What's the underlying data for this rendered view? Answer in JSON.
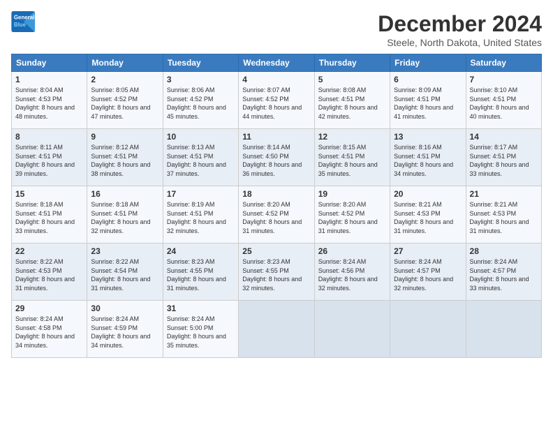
{
  "logo": {
    "line1": "General",
    "line2": "Blue"
  },
  "title": "December 2024",
  "location": "Steele, North Dakota, United States",
  "days_of_week": [
    "Sunday",
    "Monday",
    "Tuesday",
    "Wednesday",
    "Thursday",
    "Friday",
    "Saturday"
  ],
  "weeks": [
    [
      {
        "day": "1",
        "sunrise": "Sunrise: 8:04 AM",
        "sunset": "Sunset: 4:53 PM",
        "daylight": "Daylight: 8 hours and 48 minutes."
      },
      {
        "day": "2",
        "sunrise": "Sunrise: 8:05 AM",
        "sunset": "Sunset: 4:52 PM",
        "daylight": "Daylight: 8 hours and 47 minutes."
      },
      {
        "day": "3",
        "sunrise": "Sunrise: 8:06 AM",
        "sunset": "Sunset: 4:52 PM",
        "daylight": "Daylight: 8 hours and 45 minutes."
      },
      {
        "day": "4",
        "sunrise": "Sunrise: 8:07 AM",
        "sunset": "Sunset: 4:52 PM",
        "daylight": "Daylight: 8 hours and 44 minutes."
      },
      {
        "day": "5",
        "sunrise": "Sunrise: 8:08 AM",
        "sunset": "Sunset: 4:51 PM",
        "daylight": "Daylight: 8 hours and 42 minutes."
      },
      {
        "day": "6",
        "sunrise": "Sunrise: 8:09 AM",
        "sunset": "Sunset: 4:51 PM",
        "daylight": "Daylight: 8 hours and 41 minutes."
      },
      {
        "day": "7",
        "sunrise": "Sunrise: 8:10 AM",
        "sunset": "Sunset: 4:51 PM",
        "daylight": "Daylight: 8 hours and 40 minutes."
      }
    ],
    [
      {
        "day": "8",
        "sunrise": "Sunrise: 8:11 AM",
        "sunset": "Sunset: 4:51 PM",
        "daylight": "Daylight: 8 hours and 39 minutes."
      },
      {
        "day": "9",
        "sunrise": "Sunrise: 8:12 AM",
        "sunset": "Sunset: 4:51 PM",
        "daylight": "Daylight: 8 hours and 38 minutes."
      },
      {
        "day": "10",
        "sunrise": "Sunrise: 8:13 AM",
        "sunset": "Sunset: 4:51 PM",
        "daylight": "Daylight: 8 hours and 37 minutes."
      },
      {
        "day": "11",
        "sunrise": "Sunrise: 8:14 AM",
        "sunset": "Sunset: 4:50 PM",
        "daylight": "Daylight: 8 hours and 36 minutes."
      },
      {
        "day": "12",
        "sunrise": "Sunrise: 8:15 AM",
        "sunset": "Sunset: 4:51 PM",
        "daylight": "Daylight: 8 hours and 35 minutes."
      },
      {
        "day": "13",
        "sunrise": "Sunrise: 8:16 AM",
        "sunset": "Sunset: 4:51 PM",
        "daylight": "Daylight: 8 hours and 34 minutes."
      },
      {
        "day": "14",
        "sunrise": "Sunrise: 8:17 AM",
        "sunset": "Sunset: 4:51 PM",
        "daylight": "Daylight: 8 hours and 33 minutes."
      }
    ],
    [
      {
        "day": "15",
        "sunrise": "Sunrise: 8:18 AM",
        "sunset": "Sunset: 4:51 PM",
        "daylight": "Daylight: 8 hours and 33 minutes."
      },
      {
        "day": "16",
        "sunrise": "Sunrise: 8:18 AM",
        "sunset": "Sunset: 4:51 PM",
        "daylight": "Daylight: 8 hours and 32 minutes."
      },
      {
        "day": "17",
        "sunrise": "Sunrise: 8:19 AM",
        "sunset": "Sunset: 4:51 PM",
        "daylight": "Daylight: 8 hours and 32 minutes."
      },
      {
        "day": "18",
        "sunrise": "Sunrise: 8:20 AM",
        "sunset": "Sunset: 4:52 PM",
        "daylight": "Daylight: 8 hours and 31 minutes."
      },
      {
        "day": "19",
        "sunrise": "Sunrise: 8:20 AM",
        "sunset": "Sunset: 4:52 PM",
        "daylight": "Daylight: 8 hours and 31 minutes."
      },
      {
        "day": "20",
        "sunrise": "Sunrise: 8:21 AM",
        "sunset": "Sunset: 4:53 PM",
        "daylight": "Daylight: 8 hours and 31 minutes."
      },
      {
        "day": "21",
        "sunrise": "Sunrise: 8:21 AM",
        "sunset": "Sunset: 4:53 PM",
        "daylight": "Daylight: 8 hours and 31 minutes."
      }
    ],
    [
      {
        "day": "22",
        "sunrise": "Sunrise: 8:22 AM",
        "sunset": "Sunset: 4:53 PM",
        "daylight": "Daylight: 8 hours and 31 minutes."
      },
      {
        "day": "23",
        "sunrise": "Sunrise: 8:22 AM",
        "sunset": "Sunset: 4:54 PM",
        "daylight": "Daylight: 8 hours and 31 minutes."
      },
      {
        "day": "24",
        "sunrise": "Sunrise: 8:23 AM",
        "sunset": "Sunset: 4:55 PM",
        "daylight": "Daylight: 8 hours and 31 minutes."
      },
      {
        "day": "25",
        "sunrise": "Sunrise: 8:23 AM",
        "sunset": "Sunset: 4:55 PM",
        "daylight": "Daylight: 8 hours and 32 minutes."
      },
      {
        "day": "26",
        "sunrise": "Sunrise: 8:24 AM",
        "sunset": "Sunset: 4:56 PM",
        "daylight": "Daylight: 8 hours and 32 minutes."
      },
      {
        "day": "27",
        "sunrise": "Sunrise: 8:24 AM",
        "sunset": "Sunset: 4:57 PM",
        "daylight": "Daylight: 8 hours and 32 minutes."
      },
      {
        "day": "28",
        "sunrise": "Sunrise: 8:24 AM",
        "sunset": "Sunset: 4:57 PM",
        "daylight": "Daylight: 8 hours and 33 minutes."
      }
    ],
    [
      {
        "day": "29",
        "sunrise": "Sunrise: 8:24 AM",
        "sunset": "Sunset: 4:58 PM",
        "daylight": "Daylight: 8 hours and 34 minutes."
      },
      {
        "day": "30",
        "sunrise": "Sunrise: 8:24 AM",
        "sunset": "Sunset: 4:59 PM",
        "daylight": "Daylight: 8 hours and 34 minutes."
      },
      {
        "day": "31",
        "sunrise": "Sunrise: 8:24 AM",
        "sunset": "Sunset: 5:00 PM",
        "daylight": "Daylight: 8 hours and 35 minutes."
      },
      null,
      null,
      null,
      null
    ]
  ]
}
